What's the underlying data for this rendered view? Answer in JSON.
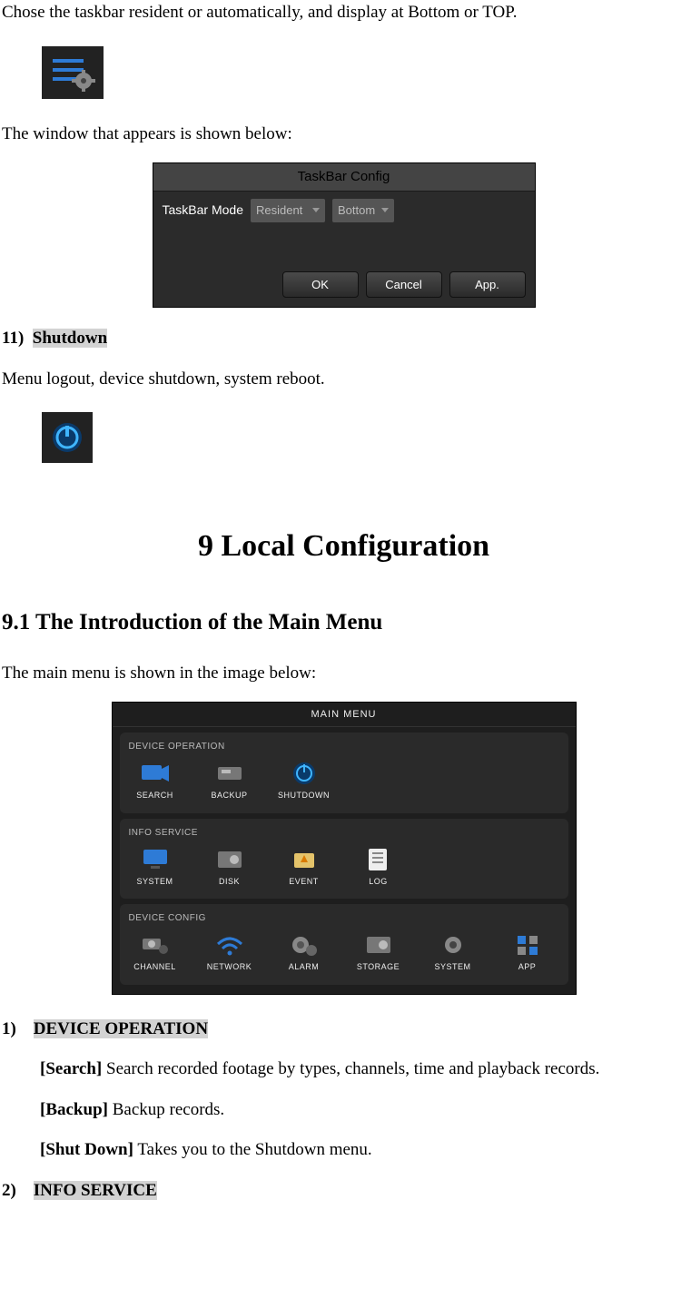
{
  "intro_text": "Chose the taskbar resident or automatically, and display at Bottom or TOP.",
  "window_caption": "The window that appears is shown below:",
  "taskbar_dialog": {
    "title": "TaskBar Config",
    "label": "TaskBar Mode",
    "option1": "Resident",
    "option2": "Bottom",
    "ok": "OK",
    "cancel": "Cancel",
    "app": "App."
  },
  "shutdown_heading_num": "11)",
  "shutdown_heading_text": "Shutdown",
  "shutdown_desc": "Menu logout, device shutdown, system reboot.",
  "chapter": "9  Local Configuration",
  "section_9_1": "9.1 The Introduction of the Main Menu",
  "main_menu_caption": "The main menu is shown in the image below:",
  "main_menu": {
    "title": "MAIN MENU",
    "panels": [
      {
        "label": "DEVICE OPERATION",
        "items": [
          "SEARCH",
          "BACKUP",
          "SHUTDOWN"
        ]
      },
      {
        "label": "INFO SERVICE",
        "items": [
          "SYSTEM",
          "DISK",
          "EVENT",
          "LOG"
        ]
      },
      {
        "label": "DEVICE CONFIG",
        "items": [
          "CHANNEL",
          "NETWORK",
          "ALARM",
          "STORAGE",
          "SYSTEM",
          "APP"
        ]
      }
    ]
  },
  "devop_num": "1)",
  "devop_title": "DEVICE OPERATION",
  "devop_search_label": "[Search]",
  "devop_search_text": " Search recorded footage by types, channels, time and playback records.",
  "devop_backup_label": "[Backup]",
  "devop_backup_text": " Backup records.",
  "devop_shutdown_label": "[Shut Down]",
  "devop_shutdown_text": " Takes you to the Shutdown menu.",
  "info_num": "2)",
  "info_title": "INFO SERVICE"
}
